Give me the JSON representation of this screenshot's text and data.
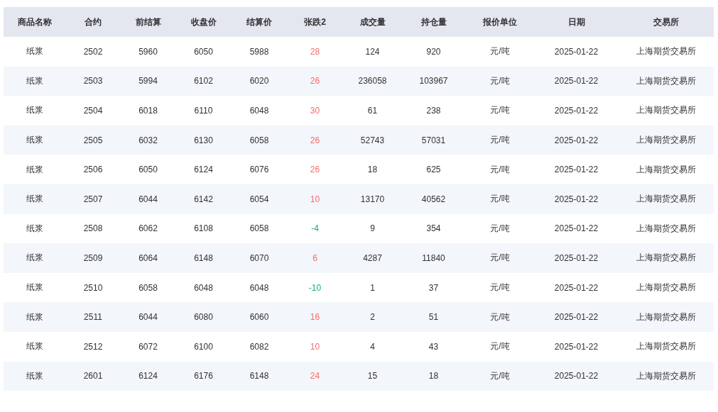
{
  "table": {
    "columns": [
      "商品名称",
      "合约",
      "前结算",
      "收盘价",
      "结算价",
      "张跌2",
      "成交量",
      "持仓量",
      "报价单位",
      "日期",
      "交易所"
    ],
    "rows": [
      {
        "name": "纸浆",
        "contract": "2502",
        "prev_settle": "5960",
        "close": "6050",
        "settle": "5988",
        "change": {
          "text": "28",
          "color": "#f56c6c"
        },
        "volume": "124",
        "open_interest": "920",
        "unit": "元/吨",
        "date": "2025-01-22",
        "exchange": "上海期货交易所"
      },
      {
        "name": "纸浆",
        "contract": "2503",
        "prev_settle": "5994",
        "close": "6102",
        "settle": "6020",
        "change": {
          "text": "26",
          "color": "#f56c6c"
        },
        "volume": "236058",
        "open_interest": "103967",
        "unit": "元/吨",
        "date": "2025-01-22",
        "exchange": "上海期货交易所"
      },
      {
        "name": "纸浆",
        "contract": "2504",
        "prev_settle": "6018",
        "close": "6110",
        "settle": "6048",
        "change": {
          "text": "30",
          "color": "#f56c6c"
        },
        "volume": "61",
        "open_interest": "238",
        "unit": "元/吨",
        "date": "2025-01-22",
        "exchange": "上海期货交易所"
      },
      {
        "name": "纸浆",
        "contract": "2505",
        "prev_settle": "6032",
        "close": "6130",
        "settle": "6058",
        "change": {
          "text": "26",
          "color": "#f56c6c"
        },
        "volume": "52743",
        "open_interest": "57031",
        "unit": "元/吨",
        "date": "2025-01-22",
        "exchange": "上海期货交易所"
      },
      {
        "name": "纸浆",
        "contract": "2506",
        "prev_settle": "6050",
        "close": "6124",
        "settle": "6076",
        "change": {
          "text": "26",
          "color": "#f56c6c"
        },
        "volume": "18",
        "open_interest": "625",
        "unit": "元/吨",
        "date": "2025-01-22",
        "exchange": "上海期货交易所"
      },
      {
        "name": "纸浆",
        "contract": "2507",
        "prev_settle": "6044",
        "close": "6142",
        "settle": "6054",
        "change": {
          "text": "10",
          "color": "#f56c6c"
        },
        "volume": "13170",
        "open_interest": "40562",
        "unit": "元/吨",
        "date": "2025-01-22",
        "exchange": "上海期货交易所"
      },
      {
        "name": "纸浆",
        "contract": "2508",
        "prev_settle": "6062",
        "close": "6108",
        "settle": "6058",
        "change": {
          "text": "-4",
          "color": "#1aaa7a"
        },
        "volume": "9",
        "open_interest": "354",
        "unit": "元/吨",
        "date": "2025-01-22",
        "exchange": "上海期货交易所"
      },
      {
        "name": "纸浆",
        "contract": "2509",
        "prev_settle": "6064",
        "close": "6148",
        "settle": "6070",
        "change": {
          "text": "6",
          "color": "#f56c6c"
        },
        "volume": "4287",
        "open_interest": "11840",
        "unit": "元/吨",
        "date": "2025-01-22",
        "exchange": "上海期货交易所"
      },
      {
        "name": "纸浆",
        "contract": "2510",
        "prev_settle": "6058",
        "close": "6048",
        "settle": "6048",
        "change": {
          "text": "-10",
          "color": "#1aaa7a"
        },
        "volume": "1",
        "open_interest": "37",
        "unit": "元/吨",
        "date": "2025-01-22",
        "exchange": "上海期货交易所"
      },
      {
        "name": "纸浆",
        "contract": "2511",
        "prev_settle": "6044",
        "close": "6080",
        "settle": "6060",
        "change": {
          "text": "16",
          "color": "#f56c6c"
        },
        "volume": "2",
        "open_interest": "51",
        "unit": "元/吨",
        "date": "2025-01-22",
        "exchange": "上海期货交易所"
      },
      {
        "name": "纸浆",
        "contract": "2512",
        "prev_settle": "6072",
        "close": "6100",
        "settle": "6082",
        "change": {
          "text": "10",
          "color": "#f56c6c"
        },
        "volume": "4",
        "open_interest": "43",
        "unit": "元/吨",
        "date": "2025-01-22",
        "exchange": "上海期货交易所"
      },
      {
        "name": "纸浆",
        "contract": "2601",
        "prev_settle": "6124",
        "close": "6176",
        "settle": "6148",
        "change": {
          "text": "24",
          "color": "#f56c6c"
        },
        "volume": "15",
        "open_interest": "18",
        "unit": "元/吨",
        "date": "2025-01-22",
        "exchange": "上海期货交易所"
      }
    ]
  }
}
